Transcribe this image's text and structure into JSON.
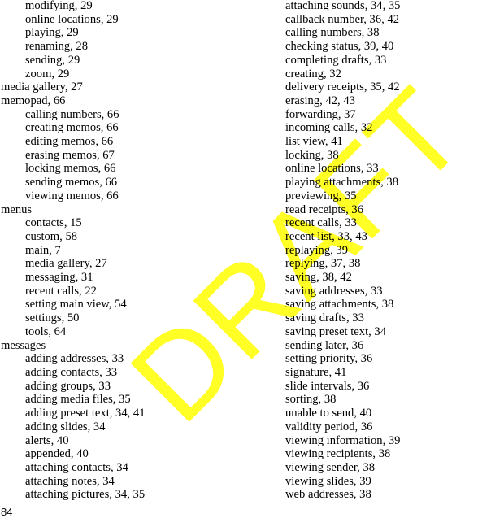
{
  "watermark": {
    "text": "DRAFT",
    "color": "#ffff00"
  },
  "footer": {
    "page_number": "84"
  },
  "left_column": [
    {
      "text": "modifying, 29",
      "level": 1
    },
    {
      "text": "online locations, 29",
      "level": 1
    },
    {
      "text": "playing, 29",
      "level": 1
    },
    {
      "text": "renaming, 28",
      "level": 1
    },
    {
      "text": "sending, 29",
      "level": 1
    },
    {
      "text": "zoom, 29",
      "level": 1
    },
    {
      "text": "media gallery, 27",
      "level": 0
    },
    {
      "text": "memopad, 66",
      "level": 0
    },
    {
      "text": "calling numbers, 66",
      "level": 1
    },
    {
      "text": "creating memos, 66",
      "level": 1
    },
    {
      "text": "editing memos, 66",
      "level": 1
    },
    {
      "text": "erasing memos, 67",
      "level": 1
    },
    {
      "text": "locking memos, 66",
      "level": 1
    },
    {
      "text": "sending memos, 66",
      "level": 1
    },
    {
      "text": "viewing memos, 66",
      "level": 1
    },
    {
      "text": "menus",
      "level": 0
    },
    {
      "text": "contacts, 15",
      "level": 1
    },
    {
      "text": "custom, 58",
      "level": 1
    },
    {
      "text": "main, 7",
      "level": 1
    },
    {
      "text": "media gallery, 27",
      "level": 1
    },
    {
      "text": "messaging, 31",
      "level": 1
    },
    {
      "text": "recent calls, 22",
      "level": 1
    },
    {
      "text": "setting main view, 54",
      "level": 1
    },
    {
      "text": "settings, 50",
      "level": 1
    },
    {
      "text": "tools, 64",
      "level": 1
    },
    {
      "text": "messages",
      "level": 0
    },
    {
      "text": "adding addresses, 33",
      "level": 1
    },
    {
      "text": "adding contacts, 33",
      "level": 1
    },
    {
      "text": "adding groups, 33",
      "level": 1
    },
    {
      "text": "adding media files, 35",
      "level": 1
    },
    {
      "text": "adding preset text, 34, 41",
      "level": 1
    },
    {
      "text": "adding slides, 34",
      "level": 1
    },
    {
      "text": "alerts, 40",
      "level": 1
    },
    {
      "text": "appended, 40",
      "level": 1
    },
    {
      "text": "attaching contacts, 34",
      "level": 1
    },
    {
      "text": "attaching notes, 34",
      "level": 1
    },
    {
      "text": "attaching pictures, 34, 35",
      "level": 1
    }
  ],
  "right_column": [
    {
      "text": "attaching sounds, 34, 35",
      "level": 1
    },
    {
      "text": "callback number, 36, 42",
      "level": 1
    },
    {
      "text": "calling numbers, 38",
      "level": 1
    },
    {
      "text": "checking status, 39, 40",
      "level": 1
    },
    {
      "text": "completing drafts, 33",
      "level": 1
    },
    {
      "text": "creating, 32",
      "level": 1
    },
    {
      "text": "delivery receipts, 35, 42",
      "level": 1
    },
    {
      "text": "erasing, 42, 43",
      "level": 1
    },
    {
      "text": "forwarding, 37",
      "level": 1
    },
    {
      "text": "incoming calls, 32",
      "level": 1
    },
    {
      "text": "list view, 41",
      "level": 1
    },
    {
      "text": "locking, 38",
      "level": 1
    },
    {
      "text": "online locations, 33",
      "level": 1
    },
    {
      "text": "playing attachments, 38",
      "level": 1
    },
    {
      "text": "previewing, 35",
      "level": 1
    },
    {
      "text": "read receipts, 36",
      "level": 1
    },
    {
      "text": "recent calls, 33",
      "level": 1
    },
    {
      "text": "recent list, 33, 43",
      "level": 1
    },
    {
      "text": "replaying, 39",
      "level": 1
    },
    {
      "text": "replying, 37, 38",
      "level": 1
    },
    {
      "text": "saving, 38, 42",
      "level": 1
    },
    {
      "text": "saving addresses, 33",
      "level": 1
    },
    {
      "text": "saving attachments, 38",
      "level": 1
    },
    {
      "text": "saving drafts, 33",
      "level": 1
    },
    {
      "text": "saving preset text, 34",
      "level": 1
    },
    {
      "text": "sending later, 36",
      "level": 1
    },
    {
      "text": "setting priority, 36",
      "level": 1
    },
    {
      "text": "signature, 41",
      "level": 1
    },
    {
      "text": "slide intervals, 36",
      "level": 1
    },
    {
      "text": "sorting, 38",
      "level": 1
    },
    {
      "text": "unable to send, 40",
      "level": 1
    },
    {
      "text": "validity period, 36",
      "level": 1
    },
    {
      "text": "viewing information, 39",
      "level": 1
    },
    {
      "text": "viewing recipients, 38",
      "level": 1
    },
    {
      "text": "viewing sender, 38",
      "level": 1
    },
    {
      "text": "viewing slides, 39",
      "level": 1
    },
    {
      "text": "web addresses, 38",
      "level": 1
    }
  ]
}
